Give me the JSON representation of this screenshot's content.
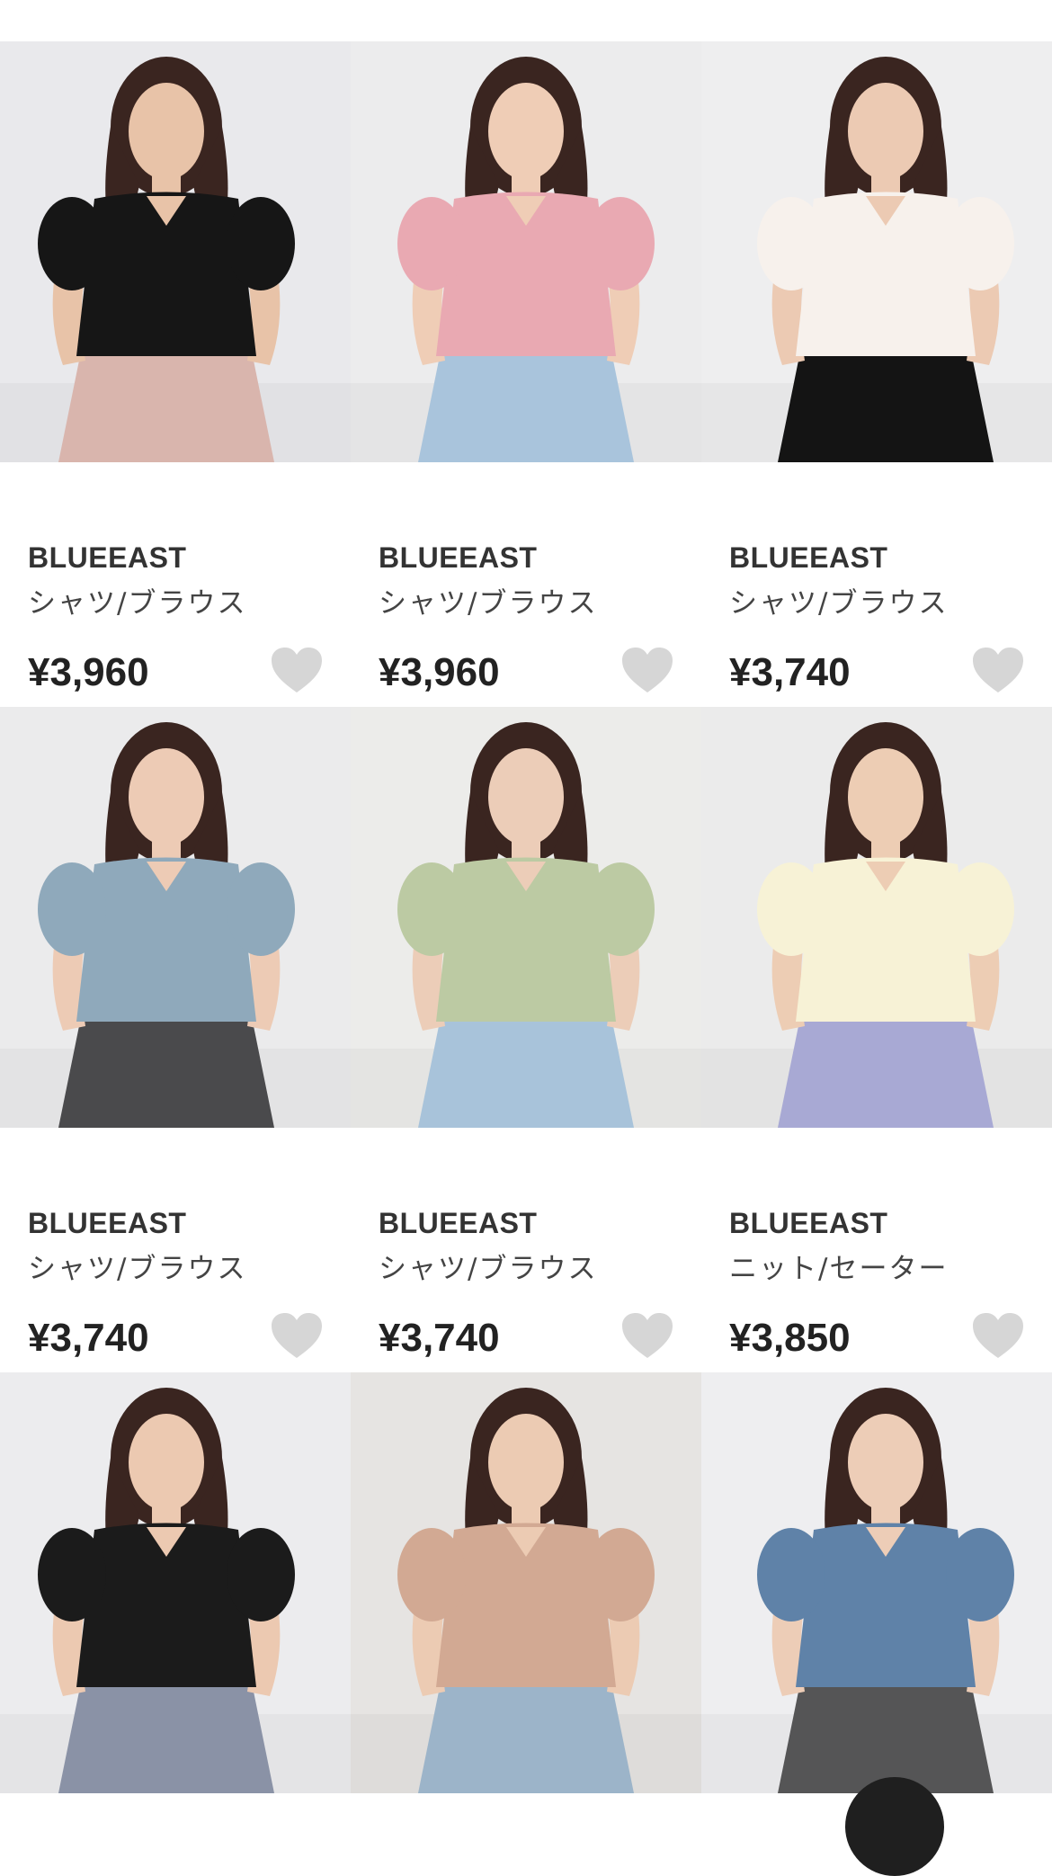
{
  "products": [
    {
      "brand": "BLUEEAST",
      "category": "シャツ/ブラウス",
      "price": "¥3,960",
      "image_subject": "black-blouse",
      "colors": {
        "bg": "#e9e9ec",
        "top": "#161616",
        "bottom": "#d9b5ad",
        "skin": "#e8c3a8"
      }
    },
    {
      "brand": "BLUEEAST",
      "category": "シャツ/ブラウス",
      "price": "¥3,960",
      "image_subject": "pink-blouse",
      "colors": {
        "bg": "#ececed",
        "top": "#e9a9b2",
        "bottom": "#a9c4dc",
        "skin": "#efcdb6"
      }
    },
    {
      "brand": "BLUEEAST",
      "category": "シャツ/ブラウス",
      "price": "¥3,740",
      "image_subject": "ivory-blouse",
      "colors": {
        "bg": "#eeeeef",
        "top": "#f7f1ec",
        "bottom": "#141414",
        "skin": "#eccab3"
      }
    },
    {
      "brand": "BLUEEAST",
      "category": "シャツ/ブラウス",
      "price": "¥3,740",
      "image_subject": "blue-blouse",
      "colors": {
        "bg": "#ebebec",
        "top": "#8fa9bb",
        "bottom": "#4a4a4c",
        "skin": "#edcbb5"
      }
    },
    {
      "brand": "BLUEEAST",
      "category": "シャツ/ブラウス",
      "price": "¥3,740",
      "image_subject": "sage-blouse",
      "colors": {
        "bg": "#ececea",
        "top": "#bccaa3",
        "bottom": "#a8c3da",
        "skin": "#eccdb8"
      }
    },
    {
      "brand": "BLUEEAST",
      "category": "ニット/セーター",
      "price": "¥3,850",
      "image_subject": "cream-knit",
      "colors": {
        "bg": "#ebebeb",
        "top": "#f7f2d6",
        "bottom": "#a8a9d4",
        "skin": "#edcdb4"
      }
    },
    {
      "brand": "",
      "category": "",
      "price": "",
      "image_subject": "black-knit",
      "colors": {
        "bg": "#ececee",
        "top": "#1b1b1b",
        "bottom": "#8a92a6",
        "skin": "#ecc9b1"
      }
    },
    {
      "brand": "",
      "category": "",
      "price": "",
      "image_subject": "beige-knit",
      "colors": {
        "bg": "#e6e4e2",
        "top": "#d2a993",
        "bottom": "#9cb4c9",
        "skin": "#eccbb3"
      }
    },
    {
      "brand": "",
      "category": "",
      "price": "",
      "image_subject": "blue-knit",
      "colors": {
        "bg": "#eeeef0",
        "top": "#5f82a8",
        "bottom": "#555556",
        "skin": "#edcdb7"
      }
    }
  ],
  "favorite_icon": "heart-icon",
  "favorite_color": "#d6d6d6",
  "floating_button_color": "#1f1f1f"
}
